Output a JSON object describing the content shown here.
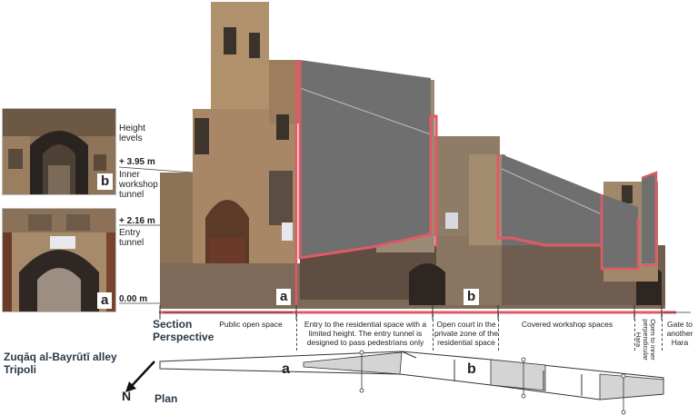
{
  "labels": {
    "height_levels": "Height levels",
    "level_top_value": "+ 3.95 m",
    "level_top_name": "Inner workshop tunnel",
    "level_mid_value": "+ 2.16 m",
    "level_mid_name": "Entry tunnel",
    "level_zero": "0.00 m",
    "marker_a": "a",
    "marker_b": "b",
    "section_perspective_1": "Section",
    "section_perspective_2": "Perspective",
    "plan": "Plan",
    "north": "N",
    "site_title_1": "Zuqāq al-Bayrūtī alley",
    "site_title_2": "Tripoli"
  },
  "zones": [
    {
      "text": "Public open space"
    },
    {
      "text": "Entry to the residential space with a limited height. The entry tunnel is designed to pass pedestrians only"
    },
    {
      "text": "Open court in the private zone of the residential space"
    },
    {
      "text": "Covered workshop spaces"
    },
    {
      "text": "Open to inner perpendicular Hara"
    },
    {
      "text": "Gate to another Hara"
    }
  ],
  "colors": {
    "section_cut": "#e05a66",
    "section_fill": "#6f6f6f",
    "stone": "#a98a66",
    "plan_fill": "#d4d4d4"
  }
}
